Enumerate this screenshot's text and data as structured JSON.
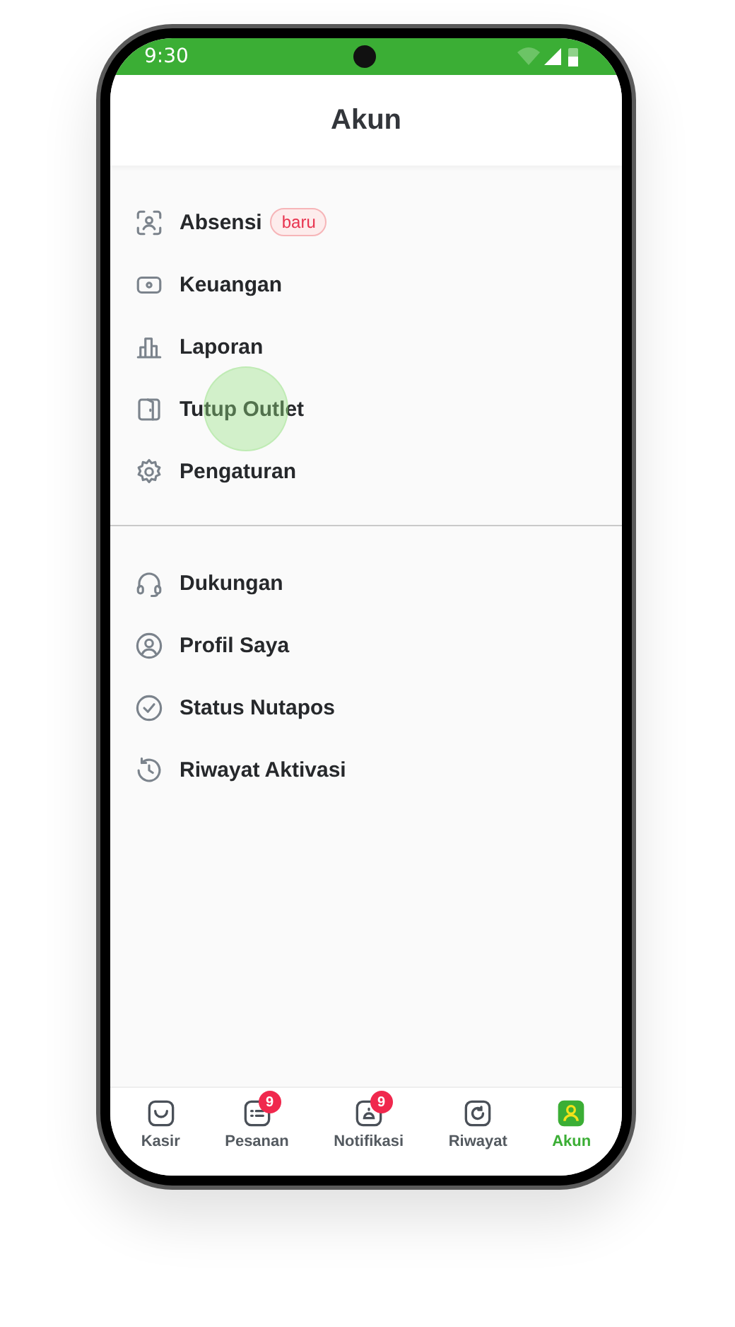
{
  "status_bar": {
    "time": "9:30"
  },
  "header": {
    "title": "Akun"
  },
  "sections": [
    {
      "items": [
        {
          "label": "Absensi",
          "badge": "baru"
        },
        {
          "label": "Keuangan"
        },
        {
          "label": "Laporan"
        },
        {
          "label": "Tutup Outlet",
          "touched": true
        },
        {
          "label": "Pengaturan"
        }
      ]
    },
    {
      "items": [
        {
          "label": "Dukungan"
        },
        {
          "label": "Profil Saya"
        },
        {
          "label": "Status Nutapos"
        },
        {
          "label": "Riwayat Aktivasi"
        }
      ]
    }
  ],
  "bottom_nav": [
    {
      "label": "Kasir",
      "selected": false
    },
    {
      "label": "Pesanan",
      "selected": false,
      "badge": "9"
    },
    {
      "label": "Notifikasi",
      "selected": false,
      "badge": "9"
    },
    {
      "label": "Riwayat",
      "selected": false
    },
    {
      "label": "Akun",
      "selected": true
    }
  ]
}
